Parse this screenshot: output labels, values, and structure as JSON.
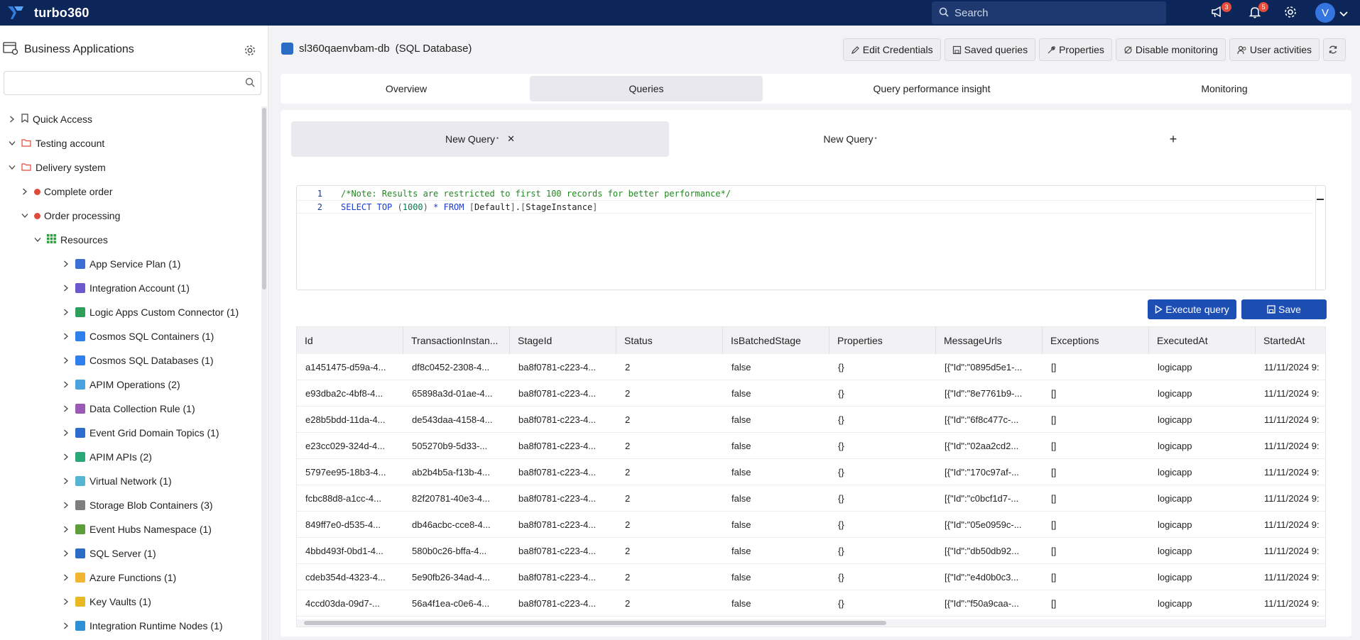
{
  "app": {
    "name": "turbo360"
  },
  "topbar": {
    "search_placeholder": "Search",
    "announcements_count": "3",
    "notifications_count": "5",
    "avatar_initial": "V"
  },
  "sidebar": {
    "title": "Business Applications",
    "search_value": "",
    "tree": [
      {
        "label": "Quick Access",
        "level": 0,
        "expanded": false,
        "kind": "bookmark"
      },
      {
        "label": "Testing account",
        "level": 0,
        "expanded": true,
        "kind": "folder"
      },
      {
        "label": "Delivery system",
        "level": 1,
        "expanded": true,
        "kind": "folder"
      },
      {
        "label": "Complete order",
        "level": 2,
        "expanded": false,
        "kind": "status-red"
      },
      {
        "label": "Order processing",
        "level": 2,
        "expanded": true,
        "kind": "status-red"
      },
      {
        "label": "Resources",
        "level": 3,
        "expanded": true,
        "kind": "grid"
      },
      {
        "label": "App Service Plan (1)",
        "level": 4,
        "expanded": false,
        "kind": "res",
        "color": "#3b6fd4"
      },
      {
        "label": "Integration Account (1)",
        "level": 4,
        "expanded": false,
        "kind": "res",
        "color": "#6a5acd"
      },
      {
        "label": "Logic Apps Custom Connector (1)",
        "level": 4,
        "expanded": false,
        "kind": "res",
        "color": "#2e9e5b"
      },
      {
        "label": "Cosmos SQL Containers (1)",
        "level": 4,
        "expanded": false,
        "kind": "res",
        "color": "#2f80ed"
      },
      {
        "label": "Cosmos SQL Databases (1)",
        "level": 4,
        "expanded": false,
        "kind": "res",
        "color": "#2f80ed"
      },
      {
        "label": "APIM Operations (2)",
        "level": 4,
        "expanded": false,
        "kind": "res",
        "color": "#4aa3df"
      },
      {
        "label": "Data Collection Rule (1)",
        "level": 4,
        "expanded": false,
        "kind": "res",
        "color": "#9b59b6"
      },
      {
        "label": "Event Grid Domain Topics (1)",
        "level": 4,
        "expanded": false,
        "kind": "res",
        "color": "#2d6ccf"
      },
      {
        "label": "APIM APIs (2)",
        "level": 4,
        "expanded": false,
        "kind": "res",
        "color": "#2aa876"
      },
      {
        "label": "Virtual Network (1)",
        "level": 4,
        "expanded": false,
        "kind": "res",
        "color": "#56b4d3"
      },
      {
        "label": "Storage Blob Containers (3)",
        "level": 4,
        "expanded": false,
        "kind": "res",
        "color": "#7f7f7f"
      },
      {
        "label": "Event Hubs Namespace (1)",
        "level": 4,
        "expanded": false,
        "kind": "res",
        "color": "#5c9e3a"
      },
      {
        "label": "SQL Server (1)",
        "level": 4,
        "expanded": false,
        "kind": "res",
        "color": "#2b6cc4"
      },
      {
        "label": "Azure Functions (1)",
        "level": 4,
        "expanded": false,
        "kind": "res",
        "color": "#f2b632"
      },
      {
        "label": "Key Vaults (1)",
        "level": 4,
        "expanded": false,
        "kind": "res",
        "color": "#e8b923"
      },
      {
        "label": "Integration Runtime Nodes (1)",
        "level": 4,
        "expanded": false,
        "kind": "res",
        "color": "#2d8fd5"
      }
    ]
  },
  "resource": {
    "name": "sl360qaenvbam-db",
    "type": "(SQL Database)"
  },
  "actions": [
    {
      "label": "Edit Credentials",
      "icon": "pencil-icon"
    },
    {
      "label": "Saved queries",
      "icon": "save-icon"
    },
    {
      "label": "Properties",
      "icon": "wrench-icon"
    },
    {
      "label": "Disable monitoring",
      "icon": "monitor-off-icon"
    },
    {
      "label": "User activities",
      "icon": "users-icon"
    }
  ],
  "tabs": [
    {
      "label": "Overview",
      "active": false
    },
    {
      "label": "Queries",
      "active": true
    },
    {
      "label": "Query performance insight",
      "active": false
    },
    {
      "label": "Monitoring",
      "active": false
    }
  ],
  "query_tabs": [
    {
      "label": "New Query",
      "modified_mark": "*",
      "active": true
    },
    {
      "label": "New Query",
      "modified_mark": "*",
      "active": false
    }
  ],
  "editor": {
    "lines": [
      {
        "number": "1",
        "text": "/*Note: Results are restricted to first 100 records for better performance*/"
      },
      {
        "number": "2",
        "text": "SELECT TOP (1000) * FROM [Default].[StageInstance]"
      }
    ]
  },
  "buttons": {
    "execute_label": "Execute query",
    "save_label": "Save"
  },
  "results": {
    "columns": [
      "Id",
      "TransactionInstan...",
      "StageId",
      "Status",
      "IsBatchedStage",
      "Properties",
      "MessageUrls",
      "Exceptions",
      "ExecutedAt",
      "StartedAt"
    ],
    "rows": [
      [
        "a1451475-d59a-4...",
        "df8c0452-2308-4...",
        "ba8f0781-c223-4...",
        "2",
        "false",
        "{}",
        "[{\"Id\":\"0895d5e1-...",
        "[]",
        "logicapp",
        "11/11/2024 9:"
      ],
      [
        "e93dba2c-4bf8-4...",
        "65898a3d-01ae-4...",
        "ba8f0781-c223-4...",
        "2",
        "false",
        "{}",
        "[{\"Id\":\"8e7761b9-...",
        "[]",
        "logicapp",
        "11/11/2024 9:"
      ],
      [
        "e28b5bdd-11da-4...",
        "de543daa-4158-4...",
        "ba8f0781-c223-4...",
        "2",
        "false",
        "{}",
        "[{\"Id\":\"6f8c477c-...",
        "[]",
        "logicapp",
        "11/11/2024 9:"
      ],
      [
        "e23cc029-324d-4...",
        "505270b9-5d33-...",
        "ba8f0781-c223-4...",
        "2",
        "false",
        "{}",
        "[{\"Id\":\"02aa2cd2...",
        "[]",
        "logicapp",
        "11/11/2024 9:"
      ],
      [
        "5797ee95-18b3-4...",
        "ab2b4b5a-f13b-4...",
        "ba8f0781-c223-4...",
        "2",
        "false",
        "{}",
        "[{\"Id\":\"170c97af-...",
        "[]",
        "logicapp",
        "11/11/2024 9:"
      ],
      [
        "fcbc88d8-a1cc-4...",
        "82f20781-40e3-4...",
        "ba8f0781-c223-4...",
        "2",
        "false",
        "{}",
        "[{\"Id\":\"c0bcf1d7-...",
        "[]",
        "logicapp",
        "11/11/2024 9:"
      ],
      [
        "849ff7e0-d535-4...",
        "db46acbc-cce8-4...",
        "ba8f0781-c223-4...",
        "2",
        "false",
        "{}",
        "[{\"Id\":\"05e0959c-...",
        "[]",
        "logicapp",
        "11/11/2024 9:"
      ],
      [
        "4bbd493f-0bd1-4...",
        "580b0c26-bffa-4...",
        "ba8f0781-c223-4...",
        "2",
        "false",
        "{}",
        "[{\"Id\":\"db50db92...",
        "[]",
        "logicapp",
        "11/11/2024 9:"
      ],
      [
        "cdeb354d-4323-4...",
        "5e90fb26-34ad-4...",
        "ba8f0781-c223-4...",
        "2",
        "false",
        "{}",
        "[{\"Id\":\"e4d0b0c3...",
        "[]",
        "logicapp",
        "11/11/2024 9:"
      ],
      [
        "4ccd03da-09d7-...",
        "56a4f1ea-c0e6-4...",
        "ba8f0781-c223-4...",
        "2",
        "false",
        "{}",
        "[{\"Id\":\"f50a9caa-...",
        "[]",
        "logicapp",
        "11/11/2024 9:"
      ]
    ]
  }
}
